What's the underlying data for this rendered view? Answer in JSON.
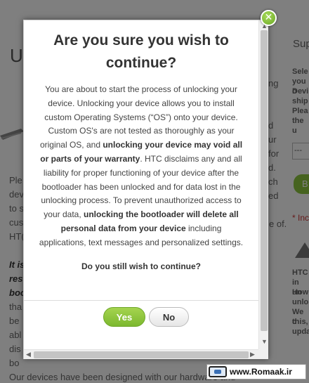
{
  "background": {
    "heading": "Ur",
    "right_header": "Sup",
    "right_para": [
      "Sele",
      "you o",
      "Devi",
      "ship",
      "Plea",
      "the u"
    ],
    "right_warning": [
      "HTC",
      "in un",
      "How",
      "unlo",
      "We c",
      "this,",
      "upda"
    ],
    "select_value": "---",
    "green_button_label": "B",
    "required_note": "* Inc",
    "mid_fragments": [
      "ng",
      "d",
      "ur",
      "for",
      "d.",
      "ch",
      "ed"
    ],
    "left_para": [
      "Ple",
      "dev",
      "to s",
      "cus",
      "HT("
    ],
    "left_bold": [
      "It is",
      "res",
      "boo"
    ],
    "left_para2": [
      "tha",
      "be",
      "abl",
      "dis",
      "bo"
    ],
    "footer_text": "Our devices have been designed with our hardware and",
    "edge_fragment": "e of."
  },
  "modal": {
    "title": "Are you sure you wish to continue?",
    "body_segments": [
      {
        "text": "You are about to start the process of unlocking your device. Unlocking your device allows you to install custom Operating Systems (“OS”) onto your device. Custom OS's are not tested as thoroughly as your original OS, and ",
        "bold": false
      },
      {
        "text": "unlocking your device may void all or parts of your warranty",
        "bold": true
      },
      {
        "text": ". HTC disclaims any and all liability for proper functioning of your device after the bootloader has been unlocked and for data lost in the unlocking process. To prevent unauthorized access to your data, ",
        "bold": false
      },
      {
        "text": "unlocking the bootloader will delete all personal data from your device",
        "bold": true
      },
      {
        "text": " including applications, text messages and personalized settings.",
        "bold": false
      }
    ],
    "question": "Do you still wish to continue?",
    "yes_label": "Yes",
    "no_label": "No",
    "close_symbol": "✕"
  },
  "icons": {
    "close": "close-icon",
    "scroll_up": "▲",
    "scroll_down": "▼",
    "scroll_left": "◀",
    "scroll_right": "▶"
  },
  "watermark": {
    "text": "www.Romaak.ir"
  },
  "colors": {
    "accent_green": "#8cc63f",
    "overlay": "rgba(0,0,0,0.5)"
  }
}
